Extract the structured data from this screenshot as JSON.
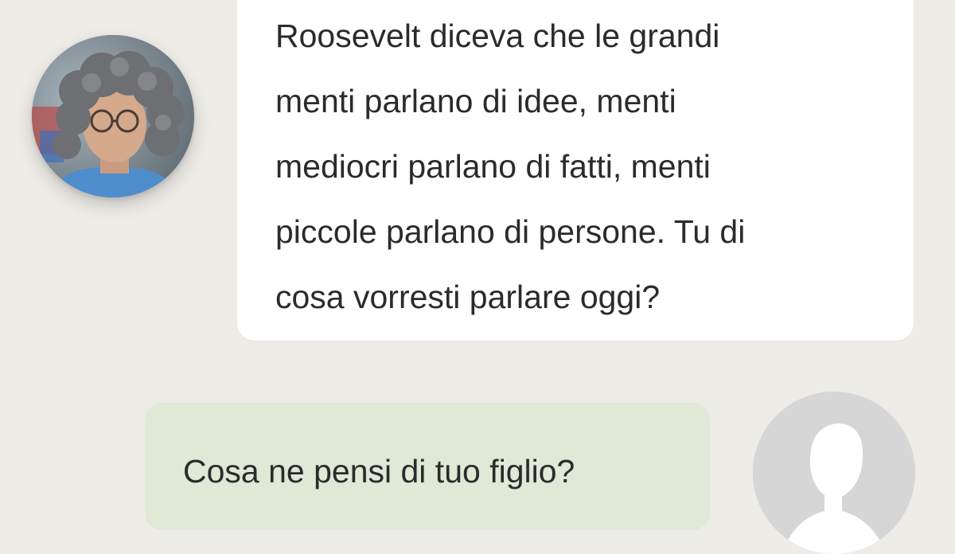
{
  "colors": {
    "background": "#eeece7",
    "bot_bubble": "#ffffff",
    "user_bubble": "#dfe9d6",
    "text": "#2b2b2b",
    "placeholder_avatar": "#d6d6d6"
  },
  "conversation": {
    "messages": [
      {
        "sender": "bot",
        "avatar": "person-photo-avatar",
        "text": "Roosevelt diceva che le grandi\nmenti parlano di idee, menti\nmediocri parlano di fatti, menti\npiccole parlano di persone. Tu di\ncosa vorresti parlare oggi?"
      },
      {
        "sender": "user",
        "avatar": "user-silhouette-icon",
        "text": "Cosa ne pensi di tuo figlio?"
      }
    ]
  }
}
